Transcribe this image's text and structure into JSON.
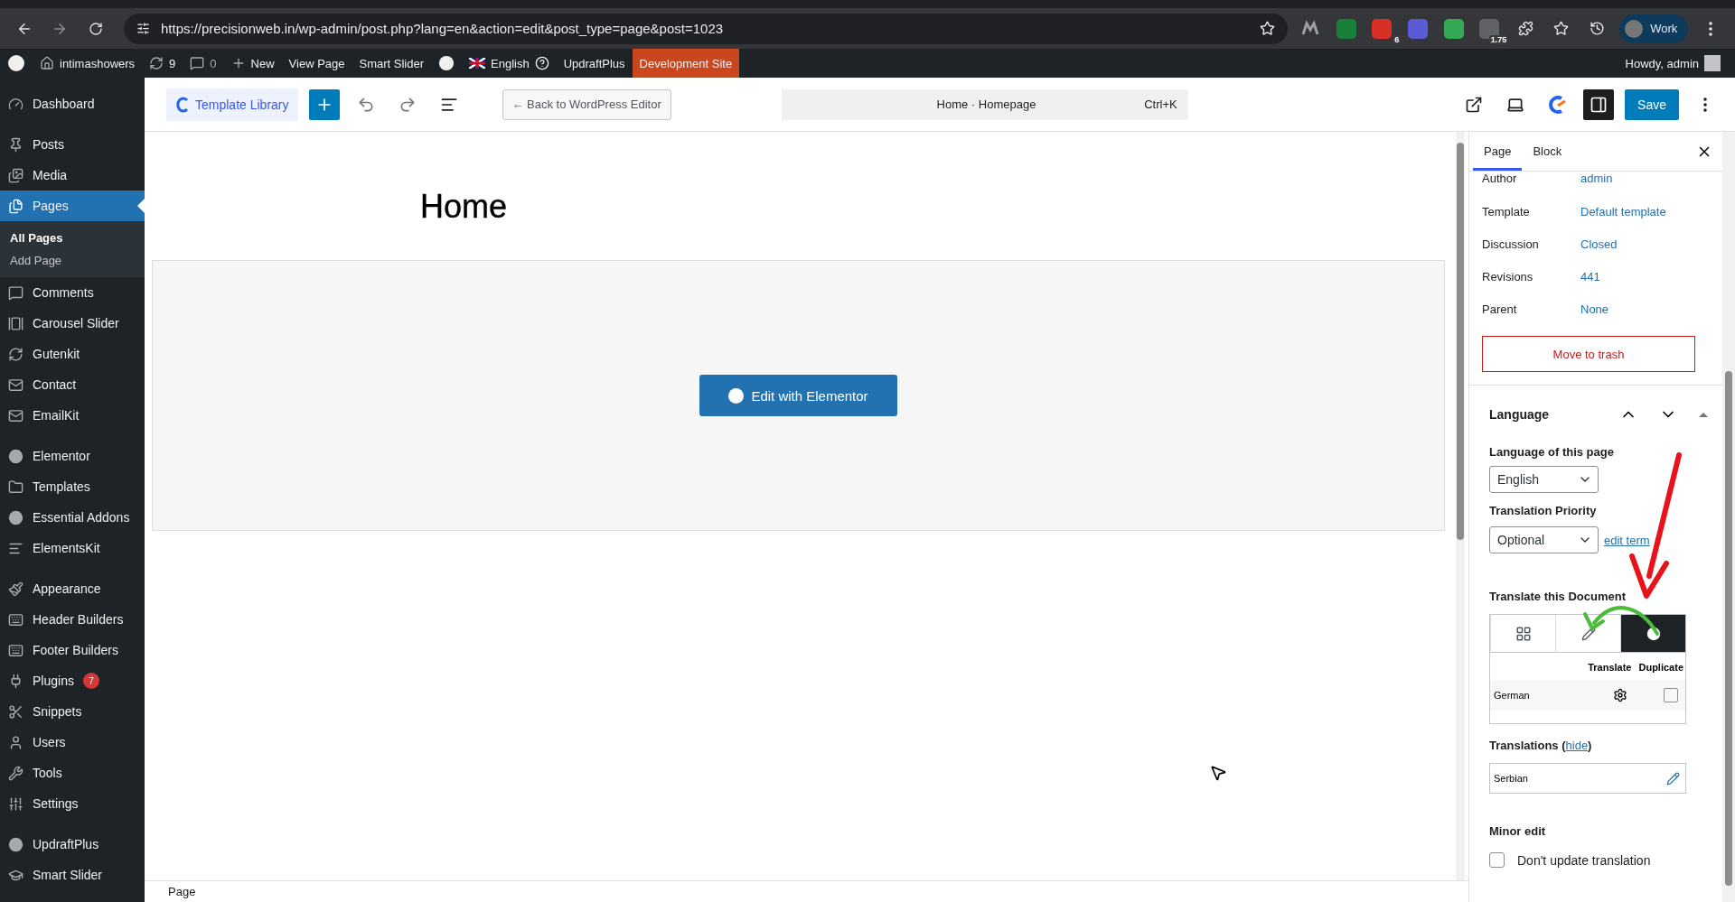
{
  "browser": {
    "url": "https://precisionweb.in/wp-admin/post.php?lang=en&action=edit&post_type=page&post=1023",
    "extension_badges": [
      "6",
      "1.75"
    ],
    "profile": "Work"
  },
  "admin_bar": {
    "site": "intimashowers",
    "updates": "9",
    "comments": "0",
    "new": "New",
    "links": [
      "View Page",
      "Smart Slider"
    ],
    "language": "English",
    "updraft": "UpdraftPlus",
    "environment": "Development Site",
    "greeting": "Howdy, admin"
  },
  "sidebar": {
    "groups": [
      [
        {
          "label": "Dashboard",
          "selected": false
        }
      ],
      [
        {
          "label": "Posts",
          "selected": false
        },
        {
          "label": "Media",
          "selected": false
        },
        {
          "label": "Pages",
          "selected": true,
          "expanded": true,
          "children": [
            {
              "label": "All Pages",
              "selected": true
            },
            {
              "label": "Add Page",
              "selected": false
            }
          ]
        },
        {
          "label": "Comments",
          "selected": false
        },
        {
          "label": "Carousel Slider",
          "selected": false
        },
        {
          "label": "Gutenkit",
          "selected": false
        },
        {
          "label": "Contact",
          "selected": false
        },
        {
          "label": "EmailKit",
          "selected": false
        }
      ],
      [
        {
          "label": "Elementor",
          "selected": false
        },
        {
          "label": "Templates",
          "selected": false
        },
        {
          "label": "Essential Addons",
          "selected": false
        },
        {
          "label": "ElementsKit",
          "selected": false
        }
      ],
      [
        {
          "label": "Appearance",
          "selected": false
        },
        {
          "label": "Header Builders",
          "selected": false
        },
        {
          "label": "Footer Builders",
          "selected": false
        },
        {
          "label": "Plugins",
          "selected": false,
          "badge": "7"
        },
        {
          "label": "Snippets",
          "selected": false
        },
        {
          "label": "Users",
          "selected": false
        },
        {
          "label": "Tools",
          "selected": false
        },
        {
          "label": "Settings",
          "selected": false
        }
      ],
      [
        {
          "label": "UpdraftPlus",
          "selected": false
        },
        {
          "label": "Smart Slider",
          "selected": false
        }
      ]
    ]
  },
  "editor_toolbar": {
    "template_library": "Template Library",
    "back_button": "← Back to WordPress Editor",
    "command": {
      "title": "Home · Homepage",
      "shortcut": "Ctrl+K"
    },
    "settings_open": true,
    "save": "Save"
  },
  "canvas": {
    "title": "Home",
    "button": "Edit with Elementor",
    "breadcrumb": "Page"
  },
  "panel": {
    "tabs": [
      {
        "label": "Page",
        "selected": true
      },
      {
        "label": "Block",
        "selected": false
      }
    ],
    "fields": [
      {
        "label": "Author",
        "value": "admin"
      },
      {
        "label": "Template",
        "value": "Default template"
      },
      {
        "label": "Discussion",
        "value": "Closed"
      },
      {
        "label": "Revisions",
        "value": "441"
      },
      {
        "label": "Parent",
        "value": "None"
      }
    ],
    "trash": "Move to trash",
    "language": {
      "title": "Language",
      "expanded": true,
      "page_language_label": "Language of this page",
      "page_language": "English",
      "priority_label": "Translation Priority",
      "priority": "Optional",
      "terms_link": "edit term",
      "translate_heading": "Translate this Document",
      "modes": [
        {
          "selected": false
        },
        {
          "selected": false
        },
        {
          "selected": true
        }
      ],
      "columns": [
        "Translate",
        "Duplicate"
      ],
      "rows": [
        {
          "language": "German",
          "duplicate": false
        }
      ],
      "translations_label": "Translations (",
      "hide_link": "hide",
      "translations_close": ")",
      "translations": [
        "Serbian"
      ],
      "minor_edit_label": "Minor edit",
      "minor_edit_option": {
        "label": "Don't update translation",
        "checked": false
      }
    }
  }
}
